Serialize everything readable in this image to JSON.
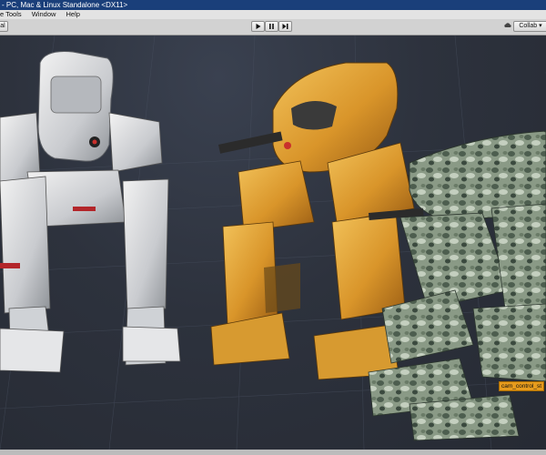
{
  "window": {
    "title": "- PC, Mac & Linux Standalone <DX11>"
  },
  "menu": {
    "items": [
      "e Tools",
      "Window",
      "Help"
    ]
  },
  "toolbar": {
    "left_label": "al",
    "play_icon": "play-icon",
    "pause_icon": "pause-icon",
    "step_icon": "step-icon",
    "collab_label": "Collab ▾"
  },
  "scene": {
    "object_label": "cam_control_st",
    "robots": [
      "white-mech",
      "yellow-mech",
      "camo-mech"
    ]
  },
  "colors": {
    "titlebar": "#1a3f7a",
    "toolbar": "#d2d2d2",
    "viewport": "#2d323d",
    "label_tag": "#e69b1d"
  }
}
